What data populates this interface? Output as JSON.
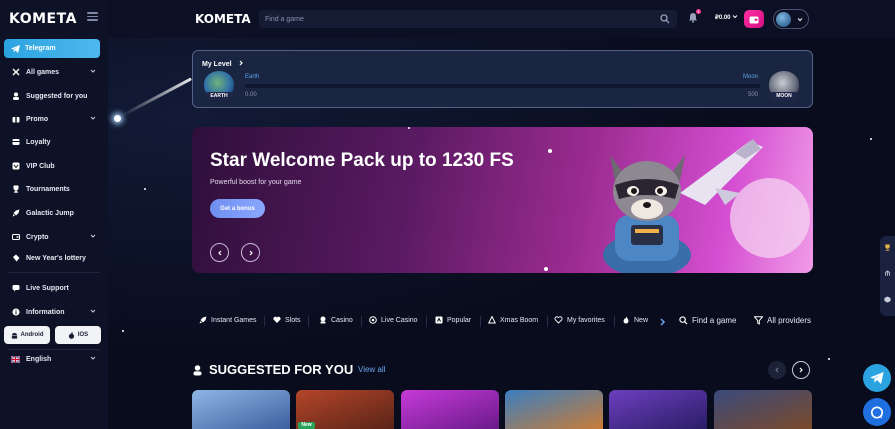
{
  "sidebar": {
    "logo": "KOMETA",
    "telegram_label": "Telegram",
    "items": [
      {
        "label": "All games",
        "icon": "x-icon",
        "chevron": true
      },
      {
        "label": "Suggested for you",
        "icon": "person-icon",
        "chevron": false
      },
      {
        "label": "Promo",
        "icon": "promo-icon",
        "chevron": true
      },
      {
        "label": "Loyalty",
        "icon": "loyalty-icon",
        "chevron": false
      },
      {
        "label": "VIP Club",
        "icon": "vip-icon",
        "chevron": false
      },
      {
        "label": "Tournaments",
        "icon": "trophy-icon",
        "chevron": false
      },
      {
        "label": "Galactic Jump",
        "icon": "rocket-icon",
        "chevron": false
      },
      {
        "label": "Crypto",
        "icon": "crypto-icon",
        "chevron": true
      },
      {
        "label": "New Year's lottery",
        "icon": "ticket-icon",
        "chevron": false
      },
      {
        "label": "Live Support",
        "icon": "support-icon",
        "chevron": false
      },
      {
        "label": "Information",
        "icon": "info-icon",
        "chevron": true
      }
    ],
    "android_label": "Android",
    "ios_label": "IOS",
    "language_label": "English"
  },
  "topbar": {
    "logo": "KOMETA",
    "search_placeholder": "Find a game",
    "notification_count": "1",
    "balance": "₽0.00"
  },
  "level": {
    "title": "My Level",
    "from_planet": "Earth",
    "to_planet": "Moon",
    "from_badge": "EARTH",
    "to_badge": "MOON",
    "min": "0.00",
    "max": "500",
    "progress": 0.0
  },
  "banner": {
    "title": "Star Welcome Pack up to 1230 FS",
    "subtitle": "Powerful boost for your game",
    "cta": "Get a bonus"
  },
  "categories": [
    {
      "label": "Instant Games",
      "icon": "rocket-icon"
    },
    {
      "label": "Slots",
      "icon": "heart-icon"
    },
    {
      "label": "Casino",
      "icon": "chip-icon"
    },
    {
      "label": "Live Casino",
      "icon": "live-icon"
    },
    {
      "label": "Popular",
      "icon": "popular-icon"
    },
    {
      "label": "Xmas Boom",
      "icon": "tree-icon"
    },
    {
      "label": "My favorites",
      "icon": "favorite-icon"
    },
    {
      "label": "New",
      "icon": "flame-icon"
    }
  ],
  "tools": {
    "find_label": "Find a game",
    "providers_label": "All providers"
  },
  "suggested": {
    "title": "SUGGESTED FOR YOU",
    "view_all": "View all",
    "new_badge": "New",
    "cards": [
      {
        "name": "game-card-1",
        "colors": [
          "#8fb6e6",
          "#3d5f9e"
        ]
      },
      {
        "name": "game-card-2",
        "colors": [
          "#b4452a",
          "#5a2417"
        ]
      },
      {
        "name": "game-card-3",
        "colors": [
          "#c63ad8",
          "#6a1a8a"
        ]
      },
      {
        "name": "game-card-4",
        "colors": [
          "#3a7fc0",
          "#c97b37"
        ]
      },
      {
        "name": "game-card-5",
        "colors": [
          "#6d3fbf",
          "#2a1d66"
        ]
      },
      {
        "name": "game-card-6",
        "colors": [
          "#3a4a7c",
          "#7a4a2a"
        ]
      }
    ]
  },
  "colors": {
    "accent": "#2ba3e0",
    "pink": "#ff2fa0",
    "link": "#6fa5f0"
  }
}
